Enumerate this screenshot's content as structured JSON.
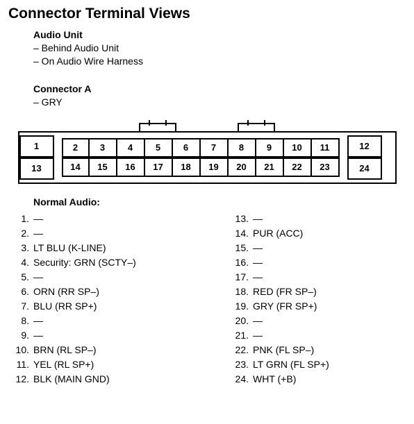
{
  "title": "Connector Terminal Views",
  "audio_unit": {
    "heading": "Audio Unit",
    "note1": "– Behind Audio Unit",
    "note2": "– On Audio Wire Harness"
  },
  "connector_a": {
    "heading": "Connector A",
    "color_note": "– GRY"
  },
  "pins_row1": [
    "1",
    "2",
    "3",
    "4",
    "5",
    "6",
    "7",
    "8",
    "9",
    "10",
    "11",
    "12"
  ],
  "pins_row2": [
    "13",
    "14",
    "15",
    "16",
    "17",
    "18",
    "19",
    "20",
    "21",
    "22",
    "23",
    "24"
  ],
  "list_heading": "Normal Audio:",
  "pin_defs_left": [
    {
      "n": "1.",
      "v": "—"
    },
    {
      "n": "2.",
      "v": "—"
    },
    {
      "n": "3.",
      "v": "LT BLU (K-LINE)"
    },
    {
      "n": "4.",
      "v": "Security: GRN (SCTY–)"
    },
    {
      "n": "5.",
      "v": "—"
    },
    {
      "n": "6.",
      "v": "ORN (RR SP–)"
    },
    {
      "n": "7.",
      "v": "BLU (RR SP+)"
    },
    {
      "n": "8.",
      "v": "—"
    },
    {
      "n": "9.",
      "v": "—"
    },
    {
      "n": "10.",
      "v": "BRN (RL SP–)"
    },
    {
      "n": "11.",
      "v": "YEL (RL SP+)"
    },
    {
      "n": "12.",
      "v": "BLK  (MAIN GND)"
    }
  ],
  "pin_defs_right": [
    {
      "n": "13.",
      "v": "—"
    },
    {
      "n": "14.",
      "v": "PUR (ACC)"
    },
    {
      "n": "15.",
      "v": "—"
    },
    {
      "n": "16.",
      "v": "—"
    },
    {
      "n": "17.",
      "v": "—"
    },
    {
      "n": "18.",
      "v": "RED (FR SP–)"
    },
    {
      "n": "19.",
      "v": "GRY (FR SP+)"
    },
    {
      "n": "20.",
      "v": "—"
    },
    {
      "n": "21.",
      "v": "—"
    },
    {
      "n": "22.",
      "v": "PNK (FL SP–)"
    },
    {
      "n": "23.",
      "v": "LT GRN (FL SP+)"
    },
    {
      "n": "24.",
      "v": "WHT (+B)"
    }
  ]
}
